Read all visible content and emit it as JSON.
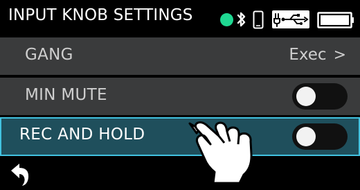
{
  "header": {
    "title": "INPUT KNOB SETTINGS",
    "status_color": "#1fd892",
    "icons": [
      "bluetooth-icon",
      "phone-icon",
      "usb-icon",
      "battery-icon"
    ]
  },
  "menu": {
    "items": [
      {
        "label": "GANG",
        "value": "Exec",
        "chevron": ">",
        "type": "action"
      },
      {
        "label": "MIN MUTE",
        "type": "toggle",
        "state": "off"
      },
      {
        "label": "REC AND HOLD",
        "type": "toggle",
        "state": "off",
        "selected": true
      }
    ]
  },
  "footer": {
    "back_icon": "back-arrow-icon"
  },
  "colors": {
    "background": "#000000",
    "row": "#3a3b3c",
    "selected_row": "#1f4f5c",
    "selected_border": "#42c2e0",
    "toggle_track": "#111111",
    "toggle_knob": "#f2f2f2"
  },
  "overlay": {
    "pointer_icon": "tapping-hand-icon"
  }
}
